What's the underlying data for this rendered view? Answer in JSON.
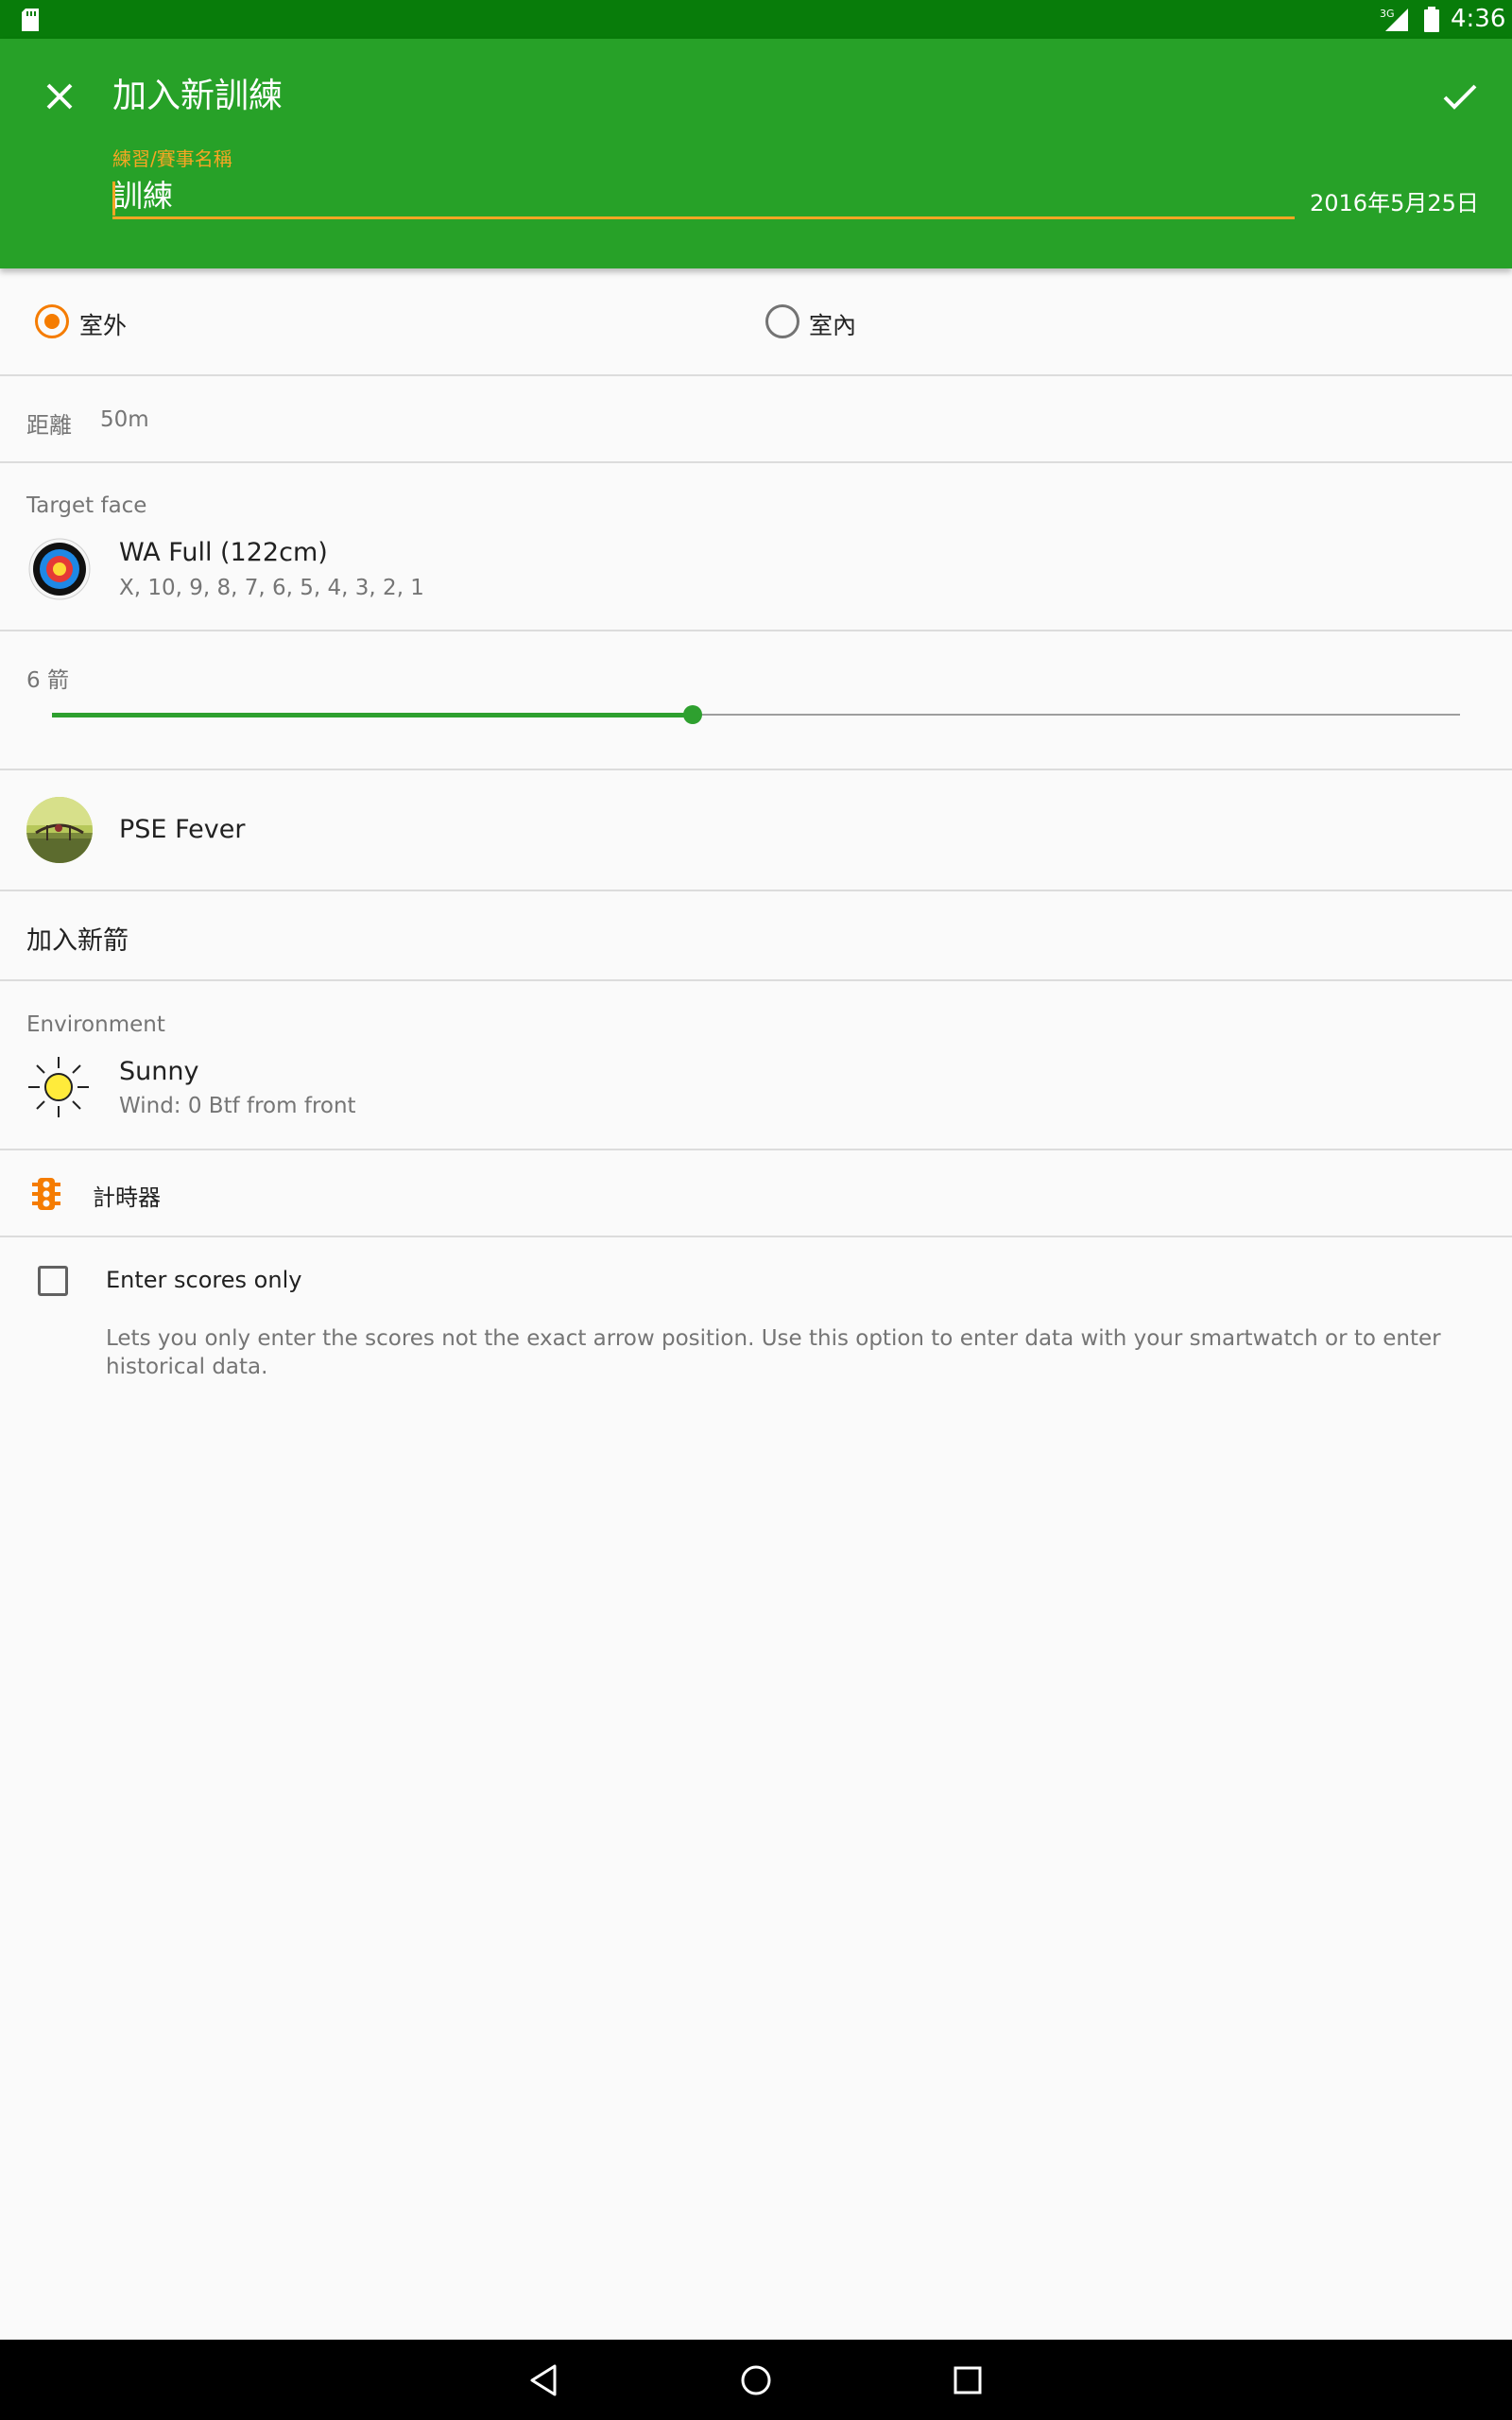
{
  "status_bar": {
    "network": "3G",
    "time": "4:36"
  },
  "app_bar": {
    "title": "加入新訓練",
    "name_field_label": "練習/賽事名稱",
    "name_field_value": "訓練",
    "date": "2016年5月25日",
    "close_icon": "close-icon",
    "confirm_icon": "check-icon"
  },
  "location": {
    "options": [
      {
        "label": "室外",
        "selected": true
      },
      {
        "label": "室內",
        "selected": false
      }
    ]
  },
  "distance": {
    "label": "距離",
    "value": "50m"
  },
  "target_face": {
    "section_label": "Target face",
    "name": "WA Full (122cm)",
    "scoring": "X, 10, 9, 8, 7, 6, 5, 4, 3, 2, 1"
  },
  "arrows_per_end": {
    "label": "6 箭",
    "fraction": 0.455
  },
  "bow": {
    "name": "PSE Fever"
  },
  "arrow": {
    "label": "加入新箭"
  },
  "environment": {
    "section_label": "Environment",
    "weather": "Sunny",
    "wind": "Wind: 0 Btf from front"
  },
  "timer": {
    "label": "計時器"
  },
  "scores_only": {
    "label": "Enter scores only",
    "checked": false,
    "description": "Lets you only enter the scores not the exact arrow position. Use this option to enter data with your smartwatch or to enter historical data."
  },
  "colors": {
    "status_bar": "#087c0a",
    "app_bar": "#27a128",
    "accent": "#f57c00",
    "slider": "#2ea02f"
  }
}
